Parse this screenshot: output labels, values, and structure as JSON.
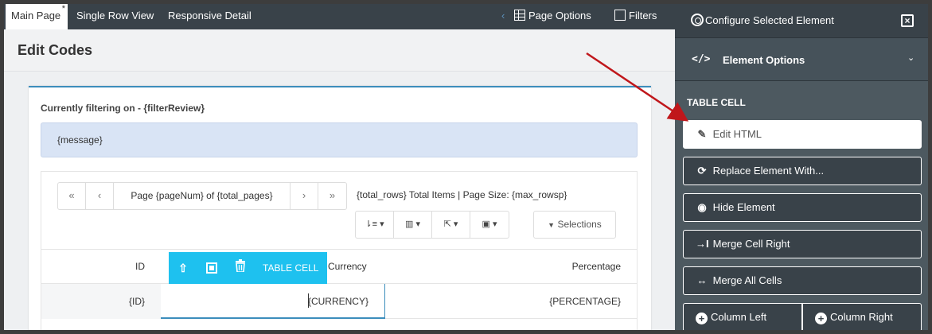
{
  "tabs": {
    "main_page": "Main Page",
    "main_page_marker": "*",
    "single_row_view": "Single Row View",
    "responsive_detail": "Responsive Detail",
    "nav_left": "‹",
    "page_options": "Page Options",
    "filters": "Filters"
  },
  "page": {
    "title": "Edit Codes"
  },
  "panel": {
    "filter_text": "Currently filtering on - {filterReview}",
    "message": "{message}"
  },
  "pager": {
    "first": "«",
    "prev": "‹",
    "info": "Page {pageNum} of {total_pages}",
    "next": "›",
    "last": "»",
    "total_info": "{total_rows} Total Items | Page Size: {max_rowsp}"
  },
  "toolbar": {
    "sort_icon": "⇂≡",
    "columns_icon": "▥",
    "export_icon": "⇱",
    "save_icon": "▣",
    "caret": "▾",
    "selections_icon": "▼",
    "selections": "Selections"
  },
  "table": {
    "headers": {
      "id": "ID",
      "currency": "Currency",
      "percentage": "Percentage"
    },
    "row": {
      "id": "{ID}",
      "currency": "{CURRENCY}",
      "percentage": "{PERCENTAGE}"
    }
  },
  "element_toolbar": {
    "up_icon": "🠕",
    "trash_icon": "🗑",
    "label": "TABLE CELL"
  },
  "sidebar": {
    "title": "Configure Selected Element",
    "close_icon": "×",
    "section_icon": "</>",
    "section_title": "Element Options",
    "chevron": "⌄",
    "group_label": "TABLE CELL",
    "buttons": {
      "edit_html": "Edit HTML",
      "edit_html_icon": "✎",
      "replace_element": "Replace Element With...",
      "replace_element_icon": "⟳",
      "hide_element": "Hide Element",
      "hide_element_icon": "◉",
      "merge_cell_right": "Merge Cell Right",
      "merge_cell_right_icon": "→I",
      "merge_all_cells": "Merge All Cells",
      "merge_all_cells_icon": "↔",
      "column_left": "Column Left",
      "column_right": "Column Right",
      "plus_icon": "+"
    }
  },
  "colors": {
    "sidebar_bg": "#394249",
    "accent": "#1ec1ef",
    "arrow": "#c0171b",
    "message_bg": "#d9e4f5"
  }
}
